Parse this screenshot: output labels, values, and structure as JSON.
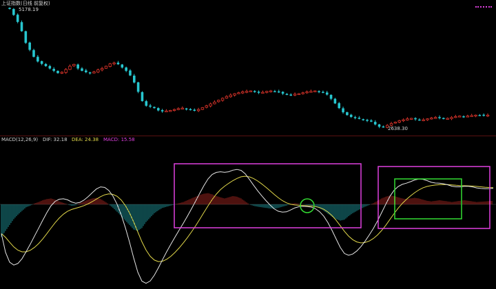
{
  "top_panel": {
    "title": "上证指数(日线 前复权)",
    "high_value": "5178.19",
    "low_value": "2638.30"
  },
  "macd_panel": {
    "label": "MACD(12,26,9)",
    "dif": "DIF: 32.18",
    "dea": "DEA: 24.38",
    "macd": "MACD: 15.58"
  },
  "colors": {
    "up": "#e0352b",
    "down": "#27c6cf",
    "dif_line": "#e6e6e6",
    "dea_line": "#e2d84a",
    "annotation_magenta": "#e040e0",
    "annotation_green": "#33dd33",
    "separator": "#7a1010"
  },
  "price_series": [
    5178,
    5050,
    4900,
    4700,
    4450,
    4300,
    4150,
    4050,
    4000,
    3950,
    3900,
    3850,
    3800,
    3820,
    3880,
    3950,
    3990,
    3900,
    3850,
    3820,
    3800,
    3830,
    3870,
    3900,
    3950,
    4000,
    4020,
    3990,
    3920,
    3850,
    3750,
    3600,
    3400,
    3200,
    3100,
    3080,
    3050,
    3000,
    2980,
    2990,
    3000,
    3020,
    3040,
    3050,
    3030,
    3010,
    3000,
    3020,
    3060,
    3100,
    3140,
    3180,
    3220,
    3260,
    3300,
    3330,
    3360,
    3380,
    3400,
    3410,
    3420,
    3400,
    3380,
    3390,
    3410,
    3420,
    3410,
    3395,
    3360,
    3340,
    3330,
    3350,
    3360,
    3380,
    3400,
    3410,
    3420,
    3400,
    3380,
    3340,
    3250,
    3150,
    3050,
    2960,
    2900,
    2860,
    2840,
    2820,
    2800,
    2780,
    2760,
    2700,
    2650,
    2640,
    2680,
    2720,
    2750,
    2780,
    2800,
    2820,
    2830,
    2810,
    2790,
    2800,
    2820,
    2840,
    2850,
    2840,
    2820,
    2830,
    2850,
    2870,
    2880,
    2870,
    2880,
    2890,
    2900,
    2900,
    2890,
    2900
  ],
  "macd_series": [
    -110,
    -90,
    -70,
    -50,
    -35,
    -22,
    -10,
    -4,
    3,
    8,
    14,
    18,
    20,
    16,
    10,
    5,
    0,
    -5,
    -3,
    4,
    10,
    16,
    20,
    22,
    18,
    10,
    0,
    -12,
    -25,
    -40,
    -55,
    -70,
    -85,
    -90,
    -80,
    -60,
    -45,
    -30,
    -20,
    -12,
    -8,
    -4,
    0,
    4,
    8,
    14,
    20,
    26,
    32,
    36,
    38,
    34,
    28,
    24,
    20,
    24,
    28,
    26,
    20,
    10,
    0,
    -5,
    -8,
    -10,
    -12,
    -14,
    -15,
    -12,
    -8,
    -4,
    2,
    4,
    2,
    0,
    -2,
    -4,
    -8,
    -14,
    -22,
    -32,
    -42,
    -50,
    -55,
    -52,
    -40,
    -30,
    -22,
    -15,
    -8,
    -2,
    4,
    12,
    20,
    26,
    30,
    28,
    24,
    20,
    18,
    20,
    22,
    20,
    16,
    12,
    10,
    12,
    14,
    12,
    10,
    8,
    10,
    12,
    14,
    12,
    10,
    8,
    9,
    10,
    11,
    12
  ]
}
